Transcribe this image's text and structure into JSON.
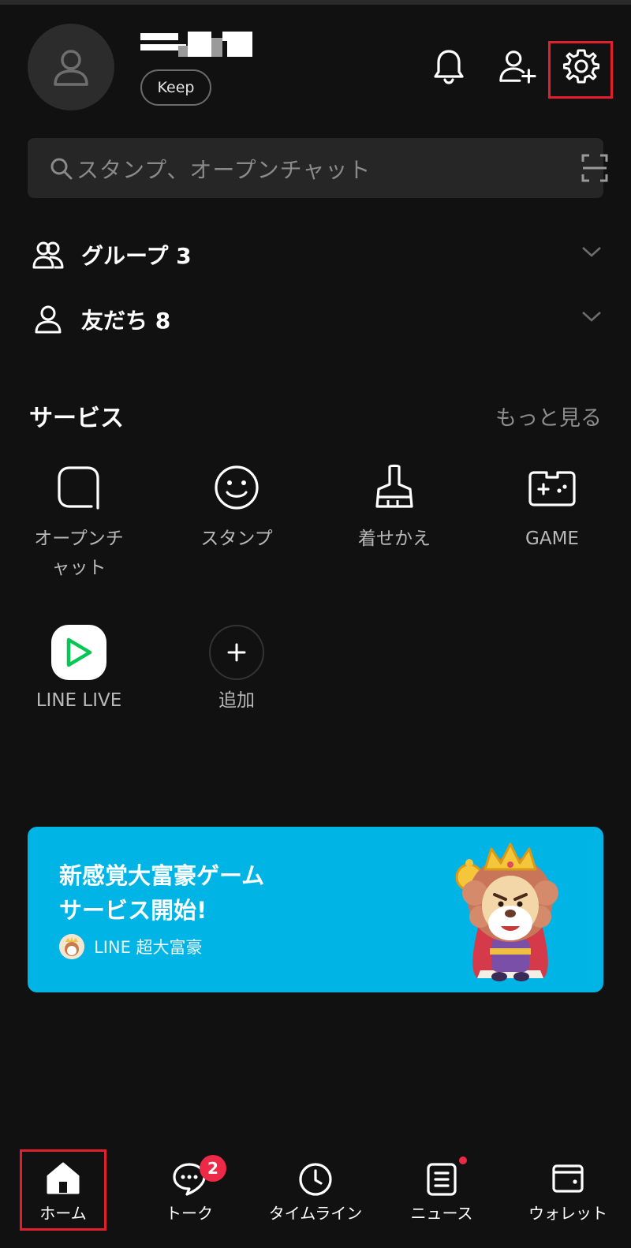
{
  "header": {
    "keep_label": "Keep"
  },
  "search": {
    "placeholder": "スタンプ、オープンチャット"
  },
  "lists": [
    {
      "label": "グループ 3"
    },
    {
      "label": "友だち 8"
    }
  ],
  "services": {
    "title": "サービス",
    "more_label": "もっと見る",
    "items": [
      {
        "label": "オープンチャット",
        "icon": "open-chat-icon"
      },
      {
        "label": "スタンプ",
        "icon": "smiley-icon"
      },
      {
        "label": "着せかえ",
        "icon": "brush-icon"
      },
      {
        "label": "GAME",
        "icon": "gamepad-icon"
      },
      {
        "label": "LINE LIVE",
        "icon": "play-icon"
      },
      {
        "label": "追加",
        "icon": "plus-icon"
      }
    ]
  },
  "banner": {
    "headline_1": "新感覚大富豪ゲーム",
    "headline_2": "サービス開始!",
    "app_name": "LINE 超大富豪",
    "background": "#00b5e5"
  },
  "nav": {
    "items": [
      {
        "label": "ホーム",
        "icon": "home-icon",
        "active": true
      },
      {
        "label": "トーク",
        "icon": "chat-icon",
        "badge": "2"
      },
      {
        "label": "タイムライン",
        "icon": "clock-icon"
      },
      {
        "label": "ニュース",
        "icon": "news-icon",
        "dot": true
      },
      {
        "label": "ウォレット",
        "icon": "wallet-icon"
      }
    ]
  },
  "colors": {
    "background": "#111111",
    "highlight": "#e0202c",
    "badge": "#ec2a47",
    "accent_green": "#06c755"
  }
}
